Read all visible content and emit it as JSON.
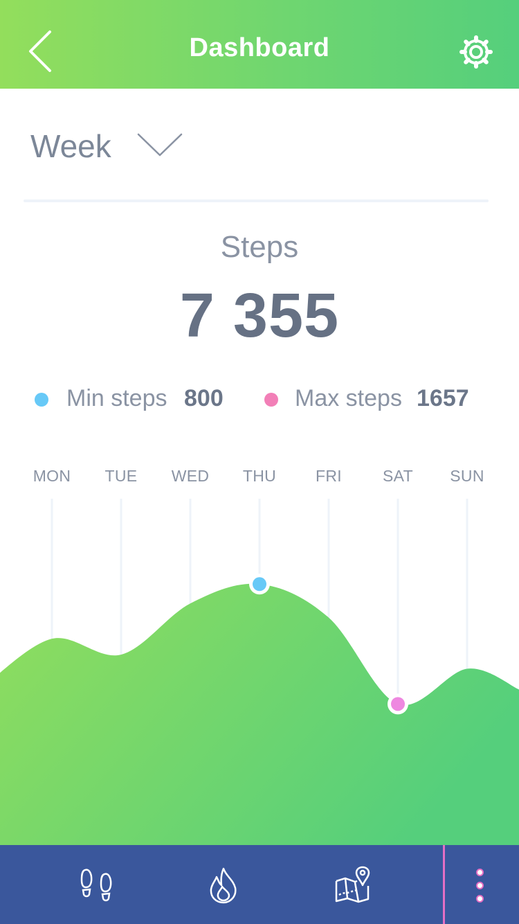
{
  "header": {
    "title": "Dashboard",
    "back_icon": "chevron-left-icon",
    "settings_icon": "gear-icon",
    "gradient": [
      "#93de5c",
      "#55cf7c"
    ]
  },
  "period": {
    "selected": "Week",
    "icon": "chevron-down-icon"
  },
  "metric": {
    "label": "Steps",
    "value": "7 355"
  },
  "legend": {
    "min": {
      "label": "Min steps",
      "value": "800",
      "color": "#67c9f7"
    },
    "max": {
      "label": "Max steps",
      "value": "1657",
      "color": "#f27fb7"
    }
  },
  "chart_data": {
    "type": "area",
    "categories": [
      "MON",
      "TUE",
      "WED",
      "THU",
      "FRI",
      "SAT",
      "SUN"
    ],
    "values": [
      1170,
      1080,
      1370,
      1480,
      1290,
      800,
      1000
    ],
    "markers": [
      {
        "day": "THU",
        "color": "#67c9f7"
      },
      {
        "day": "SAT",
        "color": "#ee88e0"
      }
    ],
    "ylim": [
      0,
      2200
    ],
    "grid": true,
    "fill_gradient": [
      "#93de5c",
      "#55cf7c"
    ]
  },
  "tabbar": {
    "background": "#3a579c",
    "accent": "#e46fc4",
    "tabs": [
      {
        "icon": "footprints-icon"
      },
      {
        "icon": "flame-icon"
      },
      {
        "icon": "map-icon"
      }
    ],
    "more_icon": "more-vertical-icon"
  }
}
